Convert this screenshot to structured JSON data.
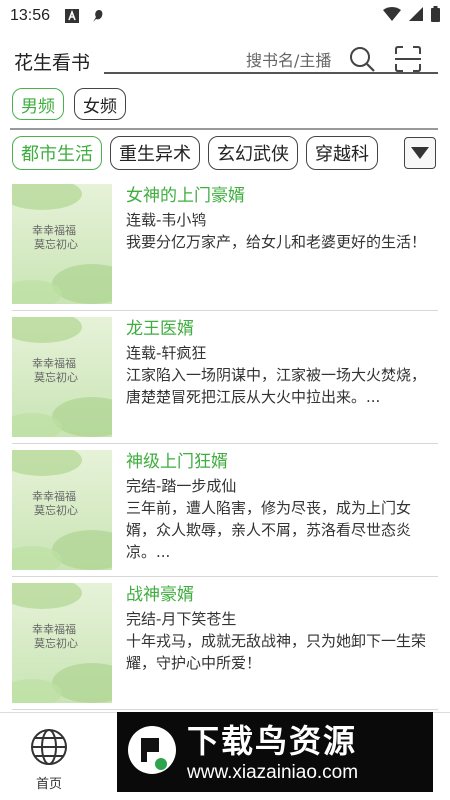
{
  "status_bar": {
    "time": "13:56",
    "icons": [
      "notification-a-icon",
      "bird-icon",
      "wifi-icon",
      "cellular-icon",
      "battery-icon"
    ]
  },
  "header": {
    "title": "花生看书",
    "search_placeholder": "搜书名/主播"
  },
  "gender_tabs": [
    {
      "label": "男频",
      "active": true
    },
    {
      "label": "女频",
      "active": false
    }
  ],
  "categories": [
    {
      "label": "都市生活",
      "active": true
    },
    {
      "label": "重生异术",
      "active": false
    },
    {
      "label": "玄幻武侠",
      "active": false
    },
    {
      "label": "穿越科",
      "active": false
    }
  ],
  "books": [
    {
      "title": "女神的上门豪婿",
      "meta": "连载-韦小鸨",
      "desc": "我要分亿万家产，给女儿和老婆更好的生活！"
    },
    {
      "title": "龙王医婿",
      "meta": "连载-轩疯狂",
      "desc": "江家陷入一场阴谋中，江家被一场大火焚烧，唐楚楚冒死把江辰从大火中拉出来。..."
    },
    {
      "title": "神级上门狂婿",
      "meta": "完结-踏一步成仙",
      "desc": "三年前，遭人陷害，修为尽丧，成为上门女婿，众人欺辱，亲人不屑，苏洛看尽世态炎凉。..."
    },
    {
      "title": "战神豪婿",
      "meta": "完结-月下笑苍生",
      "desc": "十年戎马，成就无敌战神，只为她卸下一生荣耀，守护心中所爱！"
    }
  ],
  "bottom_nav": {
    "home_label": "首页"
  },
  "watermark": {
    "title": "下载鸟资源",
    "url": "www.xiazainiao.com"
  },
  "colors": {
    "accent": "#3fae3f",
    "border": "#444444"
  }
}
